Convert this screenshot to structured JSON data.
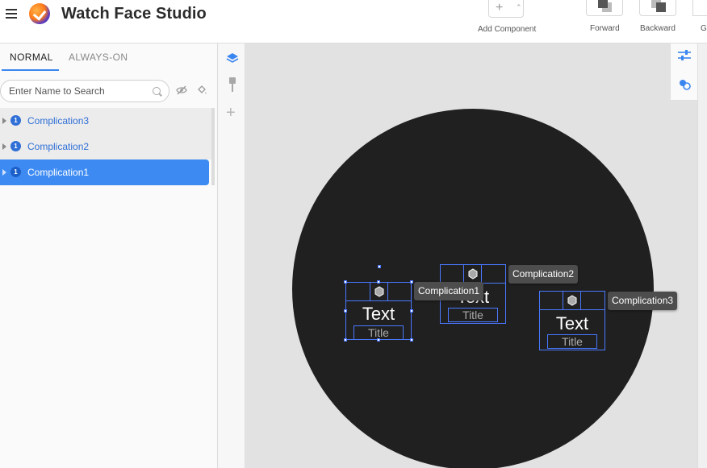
{
  "app": {
    "title": "Watch Face Studio"
  },
  "toolbar": {
    "add_component_label": "Add Component",
    "forward_label": "Forward",
    "backward_label": "Backward",
    "group_label_partial": "Gr"
  },
  "layers_panel": {
    "tabs": [
      {
        "label": "NORMAL",
        "active": true
      },
      {
        "label": "ALWAYS-ON",
        "active": false
      }
    ],
    "search": {
      "placeholder": "Enter Name to Search",
      "value": ""
    },
    "items": [
      {
        "name": "Complication3",
        "badge": "1",
        "selected": false
      },
      {
        "name": "Complication2",
        "badge": "1",
        "selected": false
      },
      {
        "name": "Complication1",
        "badge": "1",
        "selected": true
      }
    ]
  },
  "canvas": {
    "background_color": "#e2e2e2",
    "watch_face_color": "#202020",
    "selection_color": "#4a78ff",
    "complications": [
      {
        "id": "Complication1",
        "text": "Text",
        "title": "Title",
        "tooltip": "Complication1",
        "selected": true
      },
      {
        "id": "Complication2",
        "text": "Text",
        "title": "Title",
        "tooltip": "Complication2",
        "selected": false
      },
      {
        "id": "Complication3",
        "text": "Text",
        "title": "Title",
        "tooltip": "Complication3",
        "selected": false
      }
    ]
  },
  "colors": {
    "accent": "#3d8bf2",
    "badge": "#2f6fd6"
  }
}
